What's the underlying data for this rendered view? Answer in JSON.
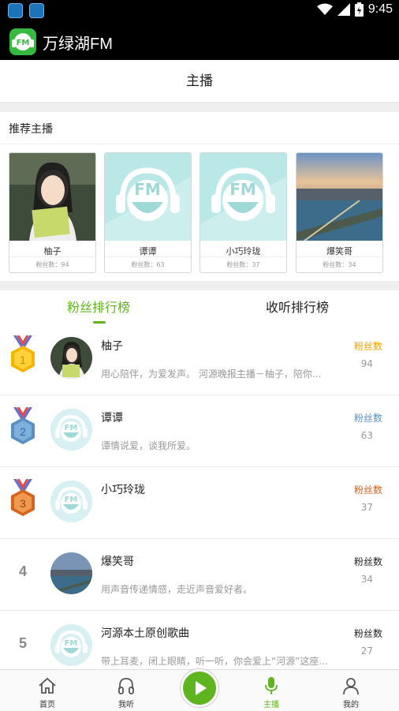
{
  "status": {
    "time": "9:45",
    "notifications": [
      "TCDI",
      "TCDI"
    ]
  },
  "app": {
    "title": "万绿湖FM"
  },
  "page": {
    "title": "主播"
  },
  "recommend": {
    "title": "推荐主播",
    "cards": [
      {
        "name": "柚子",
        "fans": "粉丝数：94",
        "image": "woman-with-book"
      },
      {
        "name": "谭谭",
        "fans": "粉丝数：63",
        "image": "fm-headphones"
      },
      {
        "name": "小巧玲珑",
        "fans": "粉丝数：37",
        "image": "fm-headphones"
      },
      {
        "name": "爆笑哥",
        "fans": "粉丝数：34",
        "image": "city-river"
      }
    ]
  },
  "tabs": {
    "fans": "粉丝排行榜",
    "listen": "收听排行榜",
    "active": "fans"
  },
  "ranking": [
    {
      "rank": "1",
      "name": "柚子",
      "desc": "用心陪伴，为爱发声。 河源晚报主播－柚子，陪你...",
      "fans_label": "粉丝数",
      "fans_value": "94",
      "label_color": "#f4a300",
      "medal": "gold",
      "avatar": "woman-with-book"
    },
    {
      "rank": "2",
      "name": "谭谭",
      "desc": "谭情说爱，谈我所爱。",
      "fans_label": "粉丝数",
      "fans_value": "63",
      "label_color": "#5a8fc2",
      "medal": "silver",
      "avatar": "fm-headphones"
    },
    {
      "rank": "3",
      "name": "小巧玲珑",
      "desc": "",
      "fans_label": "粉丝数",
      "fans_value": "37",
      "label_color": "#d4641e",
      "medal": "bronze",
      "avatar": "fm-headphones"
    },
    {
      "rank": "4",
      "name": "爆笑哥",
      "desc": "用声音传递情感，走近声音爱好者。",
      "fans_label": "粉丝数",
      "fans_value": "34",
      "label_color": "#222222",
      "medal": "",
      "avatar": "city-river"
    },
    {
      "rank": "5",
      "name": "河源本土原创歌曲",
      "desc": "带上耳麦，闭上眼睛，听一听，你会爱上“河源”这座...",
      "fans_label": "粉丝数",
      "fans_value": "27",
      "label_color": "#222222",
      "medal": "",
      "avatar": "fm-headphones"
    }
  ],
  "bottom_nav": [
    {
      "label": "首页",
      "icon": "home-icon"
    },
    {
      "label": "我听",
      "icon": "headphones-icon"
    },
    {
      "label": "",
      "icon": "play-icon"
    },
    {
      "label": "主播",
      "icon": "microphone-icon",
      "active": true
    },
    {
      "label": "我的",
      "icon": "profile-icon"
    }
  ],
  "colors": {
    "accent": "#5fb51f",
    "gold": "#f4a300",
    "silver": "#5a8fc2",
    "bronze": "#d4641e"
  }
}
